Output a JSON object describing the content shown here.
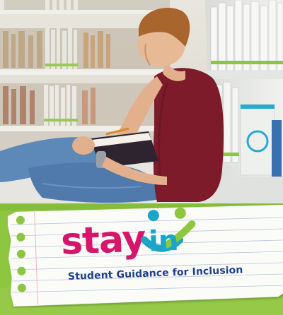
{
  "logo": {
    "wordmark_stay": "stay",
    "wordmark_in": "in",
    "tagline": "Student Guidance for Inclusion"
  },
  "colors": {
    "accent_green": "#8dc63f",
    "logo_magenta": "#d6166b",
    "logo_blue": "#1d3f8f",
    "logo_teal": "#1aa6c8",
    "logo_lime": "#8dc63f",
    "shirt": "#7d1b2a",
    "jeans": "#5d89b8"
  },
  "icons": {
    "figure_left": "person-figure-icon",
    "figure_right": "person-figure-icon"
  }
}
